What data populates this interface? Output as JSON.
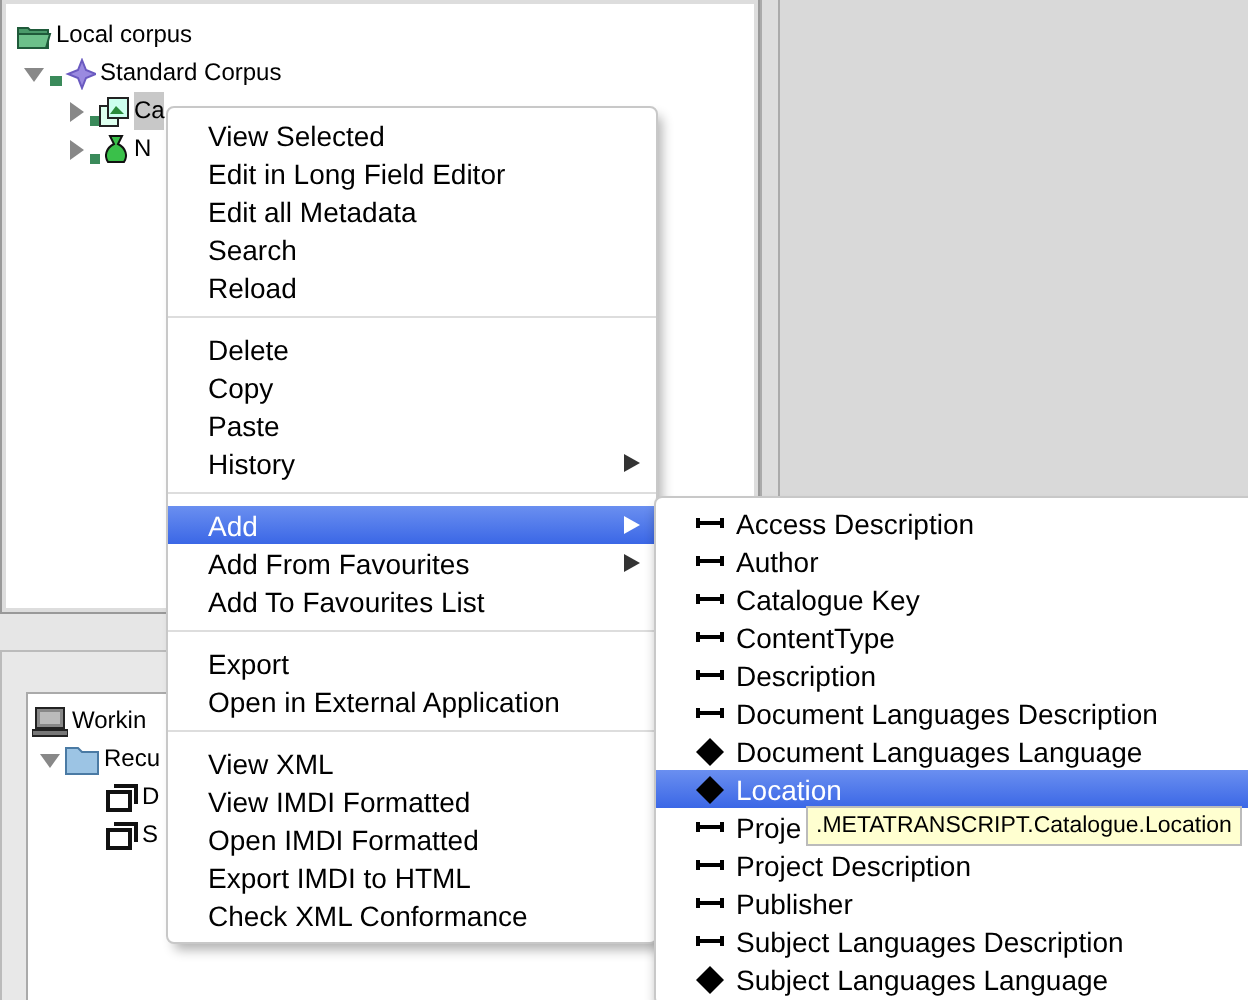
{
  "corpus_tree": [
    {
      "label": "Local corpus",
      "kind": "corpus-root",
      "children": [
        {
          "label": "Standard Corpus",
          "kind": "corpus",
          "expanded": true,
          "children": [
            {
              "label": "Ca",
              "kind": "catalogue",
              "expanded": false,
              "selected": true
            },
            {
              "label": "N",
              "kind": "session",
              "expanded": false,
              "selected": false
            }
          ]
        }
      ]
    }
  ],
  "working_tree": [
    {
      "label": "Workin",
      "kind": "computer",
      "children": [
        {
          "label": "Recu",
          "kind": "folder",
          "expanded": true,
          "children": [
            {
              "label": "D",
              "kind": "file"
            },
            {
              "label": "S",
              "kind": "file"
            }
          ]
        }
      ]
    }
  ],
  "context_menu": [
    {
      "kind": "item",
      "label": "View Selected",
      "selected": false,
      "submenu": false
    },
    {
      "kind": "item",
      "label": "Edit in Long Field Editor",
      "selected": false,
      "submenu": false
    },
    {
      "kind": "item",
      "label": "Edit all Metadata",
      "selected": false,
      "submenu": false
    },
    {
      "kind": "item",
      "label": "Search",
      "selected": false,
      "submenu": false
    },
    {
      "kind": "item",
      "label": "Reload",
      "selected": false,
      "submenu": false
    },
    {
      "kind": "separator"
    },
    {
      "kind": "item",
      "label": "Delete",
      "selected": false,
      "submenu": false
    },
    {
      "kind": "item",
      "label": "Copy",
      "selected": false,
      "submenu": false
    },
    {
      "kind": "item",
      "label": "Paste",
      "selected": false,
      "submenu": false
    },
    {
      "kind": "item",
      "label": "History",
      "selected": false,
      "submenu": true
    },
    {
      "kind": "separator"
    },
    {
      "kind": "item",
      "label": "Add",
      "selected": true,
      "submenu": true
    },
    {
      "kind": "item",
      "label": "Add From Favourites",
      "selected": false,
      "submenu": true
    },
    {
      "kind": "item",
      "label": "Add To Favourites List",
      "selected": false,
      "submenu": false
    },
    {
      "kind": "separator"
    },
    {
      "kind": "item",
      "label": "Export",
      "selected": false,
      "submenu": false
    },
    {
      "kind": "item",
      "label": "Open in External Application",
      "selected": false,
      "submenu": false
    },
    {
      "kind": "separator"
    },
    {
      "kind": "item",
      "label": "View XML",
      "selected": false,
      "submenu": false
    },
    {
      "kind": "item",
      "label": "View IMDI Formatted",
      "selected": false,
      "submenu": false
    },
    {
      "kind": "item",
      "label": "Open IMDI Formatted",
      "selected": false,
      "submenu": false
    },
    {
      "kind": "item",
      "label": "Export IMDI to HTML",
      "selected": false,
      "submenu": false
    },
    {
      "kind": "item",
      "label": "Check XML Conformance",
      "selected": false,
      "submenu": false
    }
  ],
  "add_submenu": [
    {
      "kind": "field",
      "label": "Access Description",
      "selected": false
    },
    {
      "kind": "field",
      "label": "Author",
      "selected": false
    },
    {
      "kind": "field",
      "label": "Catalogue Key",
      "selected": false
    },
    {
      "kind": "field",
      "label": "ContentType",
      "selected": false
    },
    {
      "kind": "field",
      "label": "Description",
      "selected": false
    },
    {
      "kind": "field",
      "label": "Document Languages Description",
      "selected": false
    },
    {
      "kind": "group",
      "label": "Document Languages Language",
      "selected": false
    },
    {
      "kind": "group",
      "label": "Location",
      "selected": true
    },
    {
      "kind": "field",
      "label": "Proje",
      "selected": false
    },
    {
      "kind": "field",
      "label": "Project Description",
      "selected": false
    },
    {
      "kind": "field",
      "label": "Publisher",
      "selected": false
    },
    {
      "kind": "field",
      "label": "Subject Languages Description",
      "selected": false
    },
    {
      "kind": "group",
      "label": "Subject Languages Language",
      "selected": false
    }
  ],
  "tooltip": ".METATRANSCRIPT.Catalogue.Location"
}
